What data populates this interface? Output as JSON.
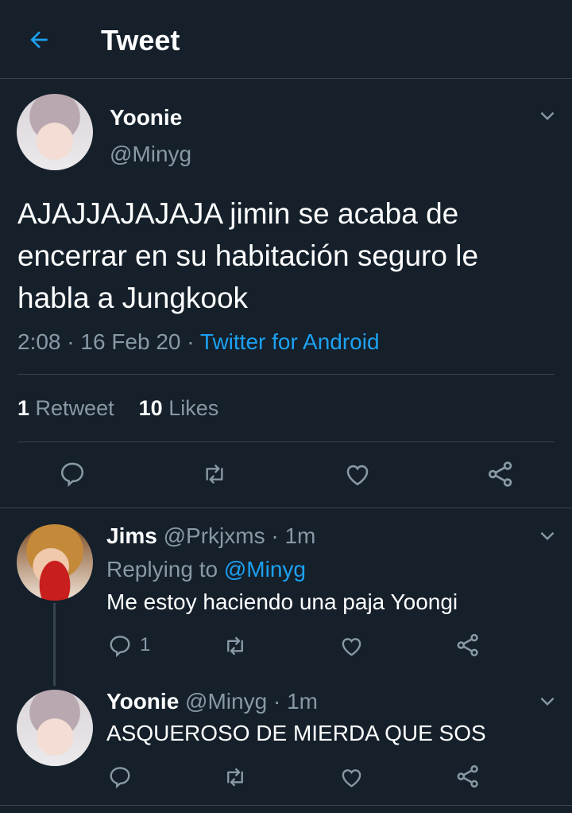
{
  "header": {
    "title": "Tweet"
  },
  "tweet": {
    "author_name": "Yoonie",
    "author_handle": "@Minyg",
    "text_line1": "AJAJJAJAJAJA jimin se acaba de",
    "text_line2": "encerrar en su habitación seguro le",
    "text_line3": "habla a Jungkook",
    "time": "2:08",
    "sep": "·",
    "date": "16 Feb 20",
    "source": "Twitter for Android",
    "retweets_count": "1",
    "retweets_label": "Retweet",
    "likes_count": "10",
    "likes_label": "Likes"
  },
  "replies": [
    {
      "name": "Jims",
      "handle": "@Prkjxms",
      "sep": "·",
      "time": "1m",
      "replying_prefix": "Replying to",
      "replying_handle": "@Minyg",
      "text": "Me estoy haciendo una paja Yoongi",
      "reply_count": "1"
    },
    {
      "name": "Yoonie",
      "handle": "@Minyg",
      "sep": "·",
      "time": "1m",
      "text": "ASQUEROSO DE MIERDA QUE SOS"
    }
  ],
  "colors": {
    "background": "#15202b",
    "accent": "#1da1f2",
    "muted": "#8899a6",
    "divider": "#38444d"
  }
}
